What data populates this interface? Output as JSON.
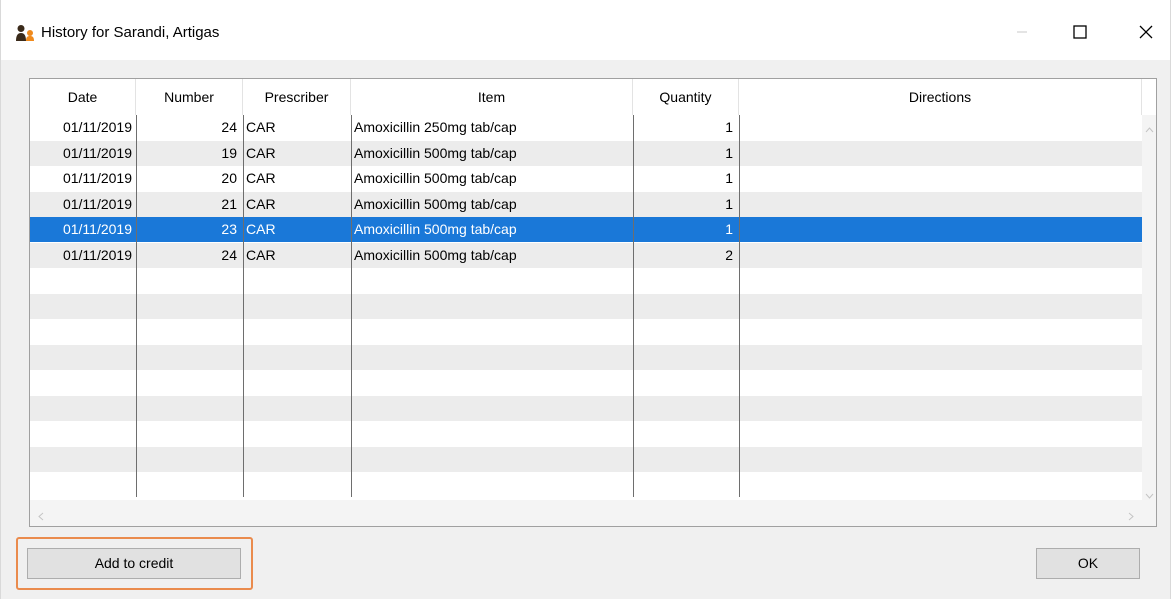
{
  "window": {
    "title": "History for Sarandi, Artigas",
    "icon": "patient-icon",
    "controls": [
      "minimize-icon",
      "maximize-icon",
      "close-icon"
    ]
  },
  "table": {
    "columns": [
      "Date",
      "Number",
      "Prescriber",
      "Item",
      "Quantity",
      "Directions"
    ],
    "rows": [
      {
        "date": "01/11/2019",
        "number": "24",
        "prescriber": "CAR",
        "item": "Amoxicillin 250mg tab/cap",
        "quantity": "1",
        "directions": ""
      },
      {
        "date": "01/11/2019",
        "number": "19",
        "prescriber": "CAR",
        "item": "Amoxicillin 500mg tab/cap",
        "quantity": "1",
        "directions": ""
      },
      {
        "date": "01/11/2019",
        "number": "20",
        "prescriber": "CAR",
        "item": "Amoxicillin 500mg tab/cap",
        "quantity": "1",
        "directions": ""
      },
      {
        "date": "01/11/2019",
        "number": "21",
        "prescriber": "CAR",
        "item": "Amoxicillin 500mg tab/cap",
        "quantity": "1",
        "directions": ""
      },
      {
        "date": "01/11/2019",
        "number": "23",
        "prescriber": "CAR",
        "item": "Amoxicillin 500mg tab/cap",
        "quantity": "1",
        "directions": ""
      },
      {
        "date": "01/11/2019",
        "number": "24",
        "prescriber": "CAR",
        "item": "Amoxicillin 500mg tab/cap",
        "quantity": "2",
        "directions": ""
      }
    ],
    "selected_row": 4,
    "total_visible_rows": 15
  },
  "buttons": {
    "add_to_credit": "Add to credit",
    "ok": "OK"
  },
  "colors": {
    "selection": "#1a78d8",
    "alt_row": "#ececec",
    "highlight": "#ea8b4d"
  }
}
